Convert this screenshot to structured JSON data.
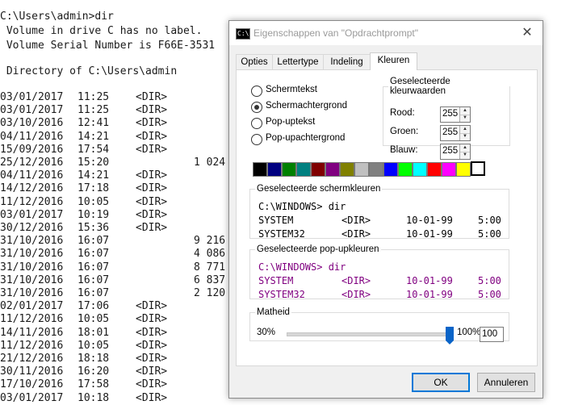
{
  "console": {
    "prompt_line": "C:\\Users\\admin>dir",
    "volume_label": " Volume in drive C has no label.",
    "serial_line": " Volume Serial Number is F66E-3531",
    "directory_line": " Directory of C:\\Users\\admin",
    "entries": [
      {
        "date": "03/01/2017",
        "time": "11:25",
        "type": "<DIR>",
        "size": ""
      },
      {
        "date": "03/01/2017",
        "time": "11:25",
        "type": "<DIR>",
        "size": ""
      },
      {
        "date": "03/10/2016",
        "time": "12:41",
        "type": "<DIR>",
        "size": ""
      },
      {
        "date": "04/11/2016",
        "time": "14:21",
        "type": "<DIR>",
        "size": ""
      },
      {
        "date": "15/09/2016",
        "time": "17:54",
        "type": "<DIR>",
        "size": ""
      },
      {
        "date": "25/12/2016",
        "time": "15:20",
        "type": "",
        "size": "1 024"
      },
      {
        "date": "04/11/2016",
        "time": "14:21",
        "type": "<DIR>",
        "size": ""
      },
      {
        "date": "14/12/2016",
        "time": "17:18",
        "type": "<DIR>",
        "size": ""
      },
      {
        "date": "11/12/2016",
        "time": "10:05",
        "type": "<DIR>",
        "size": ""
      },
      {
        "date": "03/01/2017",
        "time": "10:19",
        "type": "<DIR>",
        "size": ""
      },
      {
        "date": "30/12/2016",
        "time": "15:36",
        "type": "<DIR>",
        "size": ""
      },
      {
        "date": "31/10/2016",
        "time": "16:07",
        "type": "",
        "size": "9 216"
      },
      {
        "date": "31/10/2016",
        "time": "16:07",
        "type": "",
        "size": "4 086"
      },
      {
        "date": "31/10/2016",
        "time": "16:07",
        "type": "",
        "size": "8 771"
      },
      {
        "date": "31/10/2016",
        "time": "16:07",
        "type": "",
        "size": "6 837"
      },
      {
        "date": "31/10/2016",
        "time": "16:07",
        "type": "",
        "size": "2 120"
      },
      {
        "date": "02/01/2017",
        "time": "17:06",
        "type": "<DIR>",
        "size": ""
      },
      {
        "date": "11/12/2016",
        "time": "10:05",
        "type": "<DIR>",
        "size": ""
      },
      {
        "date": "14/11/2016",
        "time": "18:01",
        "type": "<DIR>",
        "size": ""
      },
      {
        "date": "11/12/2016",
        "time": "10:05",
        "type": "<DIR>",
        "size": ""
      },
      {
        "date": "21/12/2016",
        "time": "18:18",
        "type": "<DIR>",
        "size": ""
      },
      {
        "date": "30/11/2016",
        "time": "16:20",
        "type": "<DIR>",
        "size": ""
      },
      {
        "date": "17/10/2016",
        "time": "17:58",
        "type": "<DIR>",
        "size": ""
      },
      {
        "date": "03/01/2017",
        "time": "10:18",
        "type": "<DIR>",
        "size": ""
      }
    ]
  },
  "dialog": {
    "title": "Eigenschappen van \"Opdrachtprompt\"",
    "icon_text": "C:\\",
    "close_symbol": "✕",
    "tabs": [
      {
        "label": "Opties",
        "active": false
      },
      {
        "label": "Lettertype",
        "active": false
      },
      {
        "label": "Indeling",
        "active": false
      },
      {
        "label": "Kleuren",
        "active": true
      }
    ],
    "radios": [
      {
        "label": "Schermtekst",
        "checked": false
      },
      {
        "label": "Schermachtergrond",
        "checked": true
      },
      {
        "label": "Pop-uptekst",
        "checked": false
      },
      {
        "label": "Pop-upachtergrond",
        "checked": false
      }
    ],
    "color_values": {
      "legend": "Geselecteerde kleurwaarden",
      "red_label": "Rood:",
      "red": "255",
      "green_label": "Groen:",
      "green": "255",
      "blue_label": "Blauw:",
      "blue": "255"
    },
    "palette": [
      "#000000",
      "#000080",
      "#008000",
      "#008080",
      "#800000",
      "#800080",
      "#808000",
      "#c0c0c0",
      "#808080",
      "#0000ff",
      "#00ff00",
      "#00ffff",
      "#ff0000",
      "#ff00ff",
      "#ffff00",
      "#ffffff"
    ],
    "screen_preview": {
      "legend": "Geselecteerde schermkleuren",
      "line1": "C:\\WINDOWS> dir",
      "rows": [
        {
          "name": "SYSTEM",
          "type": "<DIR>",
          "date": "10-01-99",
          "time": "5:00"
        },
        {
          "name": "SYSTEM32",
          "type": "<DIR>",
          "date": "10-01-99",
          "time": "5:00"
        }
      ],
      "text_color": "#000000"
    },
    "popup_preview": {
      "legend": "Geselecteerde pop-upkleuren",
      "line1": "C:\\WINDOWS> dir",
      "rows": [
        {
          "name": "SYSTEM",
          "type": "<DIR>",
          "date": "10-01-99",
          "time": "5:00"
        },
        {
          "name": "SYSTEM32",
          "type": "<DIR>",
          "date": "10-01-99",
          "time": "5:00"
        }
      ],
      "text_color": "#800080"
    },
    "opacity": {
      "legend": "Matheid",
      "min_label": "30%",
      "max_label": "100%",
      "value": "100",
      "level_percent": 100
    },
    "ok_label": "OK",
    "cancel_label": "Annuleren"
  }
}
